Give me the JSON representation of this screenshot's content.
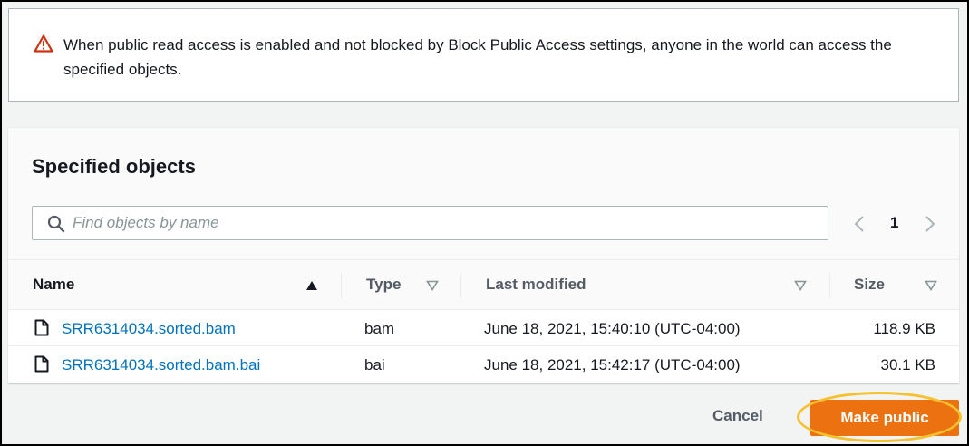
{
  "alert": {
    "icon": "warning-triangle-icon",
    "icon_color": "#d13212",
    "message": "When public read access is enabled and not blocked by Block Public Access settings, anyone in the world can access the specified objects."
  },
  "section": {
    "title": "Specified objects"
  },
  "search": {
    "icon": "search-icon",
    "placeholder": "Find objects by name",
    "value": ""
  },
  "pagination": {
    "current_page": "1"
  },
  "table": {
    "columns": [
      {
        "label": "Name",
        "sort": "ascending"
      },
      {
        "label": "Type",
        "sort": "none"
      },
      {
        "label": "Last modified",
        "sort": "none"
      },
      {
        "label": "Size",
        "sort": "none"
      }
    ],
    "rows": [
      {
        "name": "SRR6314034.sorted.bam",
        "type": "bam",
        "last_modified": "June 18, 2021, 15:40:10 (UTC-04:00)",
        "size": "118.9 KB"
      },
      {
        "name": "SRR6314034.sorted.bam.bai",
        "type": "bai",
        "last_modified": "June 18, 2021, 15:42:17 (UTC-04:00)",
        "size": "30.1 KB"
      }
    ]
  },
  "footer": {
    "cancel_label": "Cancel",
    "primary_label": "Make public",
    "primary_color": "#ec7211",
    "highlight_color": "#f5c22d"
  }
}
